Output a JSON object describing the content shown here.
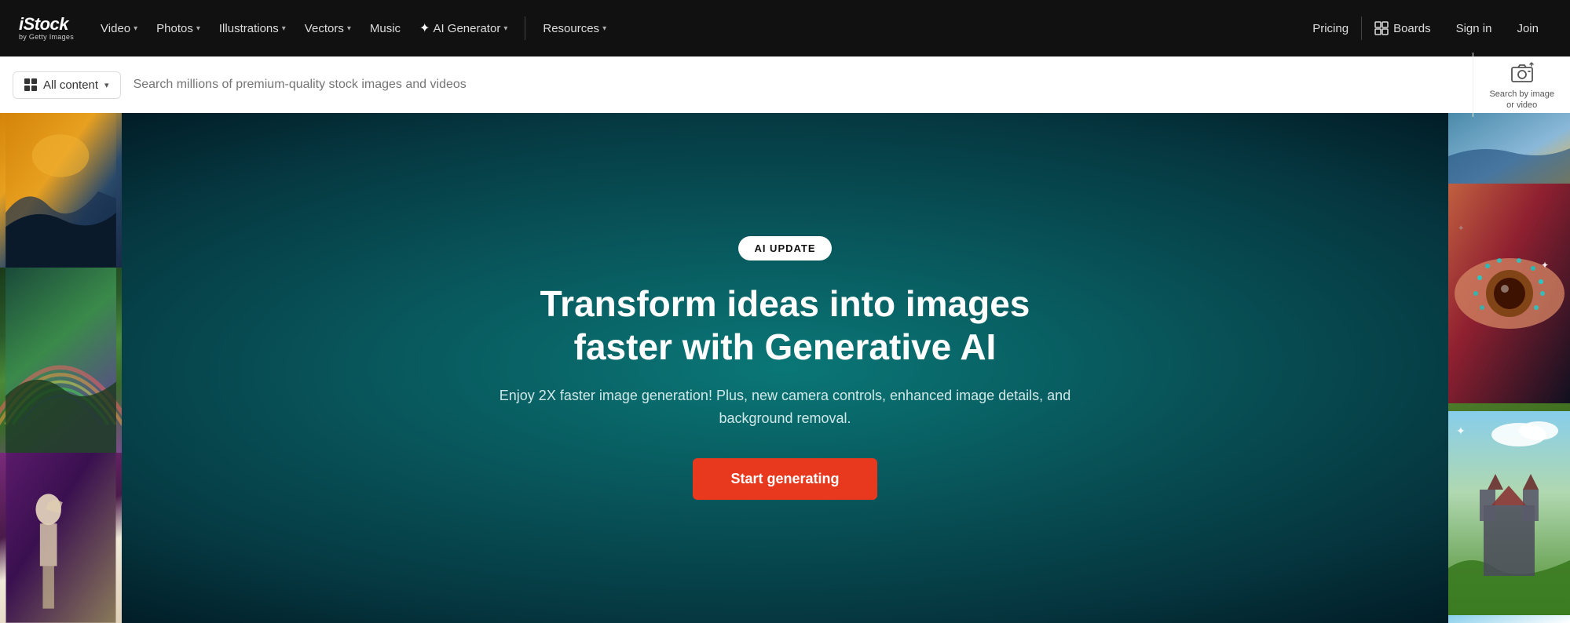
{
  "navbar": {
    "logo": {
      "brand": "iStock",
      "tagline": "by Getty Images"
    },
    "nav_items": [
      {
        "label": "Video",
        "has_dropdown": true
      },
      {
        "label": "Photos",
        "has_dropdown": true
      },
      {
        "label": "Illustrations",
        "has_dropdown": true
      },
      {
        "label": "Vectors",
        "has_dropdown": true
      },
      {
        "label": "Music",
        "has_dropdown": false
      },
      {
        "label": "AI Generator",
        "has_dropdown": true,
        "has_sparkle": true
      },
      {
        "label": "Resources",
        "has_dropdown": true
      }
    ],
    "right_items": [
      {
        "label": "Pricing"
      },
      {
        "label": "Boards"
      },
      {
        "label": "Sign in"
      },
      {
        "label": "Join"
      }
    ]
  },
  "search": {
    "content_filter": "All content",
    "placeholder": "Search millions of premium-quality stock images and videos",
    "search_by_image_label": "Search by image\nor video"
  },
  "hero": {
    "badge": "AI UPDATE",
    "title": "Transform ideas into images faster with Generative AI",
    "subtitle": "Enjoy 2X faster image generation! Plus, new camera controls, enhanced image details, and background removal.",
    "cta_button": "Start generating"
  }
}
